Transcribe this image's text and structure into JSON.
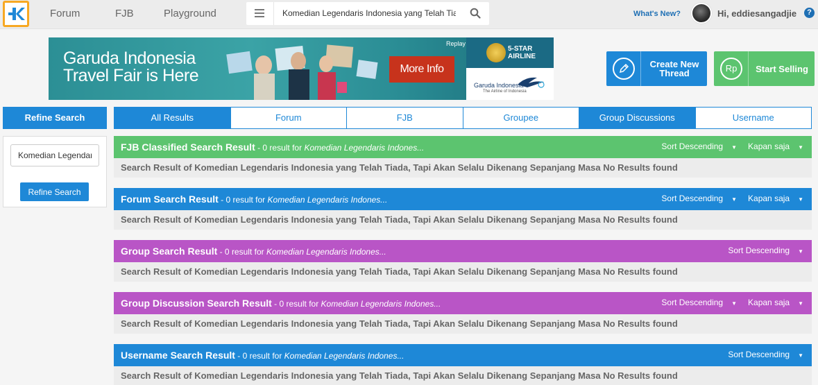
{
  "nav": {
    "logo_alt": "K",
    "links": [
      "Forum",
      "FJB",
      "Playground"
    ],
    "search_value": "Komedian Legendaris Indonesia yang Telah Tiada, Tapi Akan Selalu Dikenang Sepanjang Masa",
    "whats_new": "What's New?",
    "greeting": "Hi, eddiesangadjie",
    "help": "?"
  },
  "banner": {
    "title_line1": "Garuda Indonesia",
    "title_line2": "Travel Fair is Here",
    "cta": "More Info",
    "replay": "Replay",
    "star_line1": "5-STAR",
    "star_line2": "AIRLINE",
    "brand": "Garuda Indonesia",
    "brand_sub": "The Airline of Indonesia"
  },
  "actions": {
    "create_line1": "Create New",
    "create_line2": "Thread",
    "create_icon": "pencil-icon",
    "sell_label": "Start Selling",
    "sell_icon": "Rp"
  },
  "refine": {
    "header": "Refine Search",
    "input_value": "Komedian Legendaris Indonesia yang Telah Tiada, Tapi Akan Selalu Dikenang Sepanjang Masa",
    "button": "Refine Search"
  },
  "tabs": [
    {
      "label": "All Results",
      "active": true
    },
    {
      "label": "Forum",
      "active": false
    },
    {
      "label": "FJB",
      "active": false
    },
    {
      "label": "Groupee",
      "active": false
    },
    {
      "label": "Group Discussions",
      "active": true
    },
    {
      "label": "Username",
      "active": false
    }
  ],
  "results": [
    {
      "title": "FJB Classified Search Result",
      "meta": " - 0 result for ",
      "query": "Komedian Legendaris Indones...",
      "sort": "Sort Descending",
      "time": "Kapan saja",
      "body": "Search Result of Komedian Legendaris Indonesia yang Telah Tiada, Tapi Akan Selalu Dikenang Sepanjang Masa No Results found",
      "color": "#5cc46f"
    },
    {
      "title": "Forum Search Result",
      "meta": " - 0 result for ",
      "query": "Komedian Legendaris Indones...",
      "sort": "Sort Descending",
      "time": "Kapan saja",
      "body": "Search Result of Komedian Legendaris Indonesia yang Telah Tiada, Tapi Akan Selalu Dikenang Sepanjang Masa No Results found",
      "color": "#1e88d7"
    },
    {
      "title": "Group Search Result",
      "meta": " - 0 result for ",
      "query": "Komedian Legendaris Indones...",
      "sort": "Sort Descending",
      "body": "Search Result of Komedian Legendaris Indonesia yang Telah Tiada, Tapi Akan Selalu Dikenang Sepanjang Masa No Results found",
      "color": "#b955c6"
    },
    {
      "title": "Group Discussion Search Result",
      "meta": " - 0 result for ",
      "query": "Komedian Legendaris Indones...",
      "sort": "Sort Descending",
      "time": "Kapan saja",
      "body": "Search Result of Komedian Legendaris Indonesia yang Telah Tiada, Tapi Akan Selalu Dikenang Sepanjang Masa No Results found",
      "color": "#b955c6"
    },
    {
      "title": "Username Search Result",
      "meta": " - 0 result for ",
      "query": "Komedian Legendaris Indones...",
      "sort": "Sort Descending",
      "body": "Search Result of Komedian Legendaris Indonesia yang Telah Tiada, Tapi Akan Selalu Dikenang Sepanjang Masa No Results found",
      "color": "#1e88d7"
    }
  ]
}
